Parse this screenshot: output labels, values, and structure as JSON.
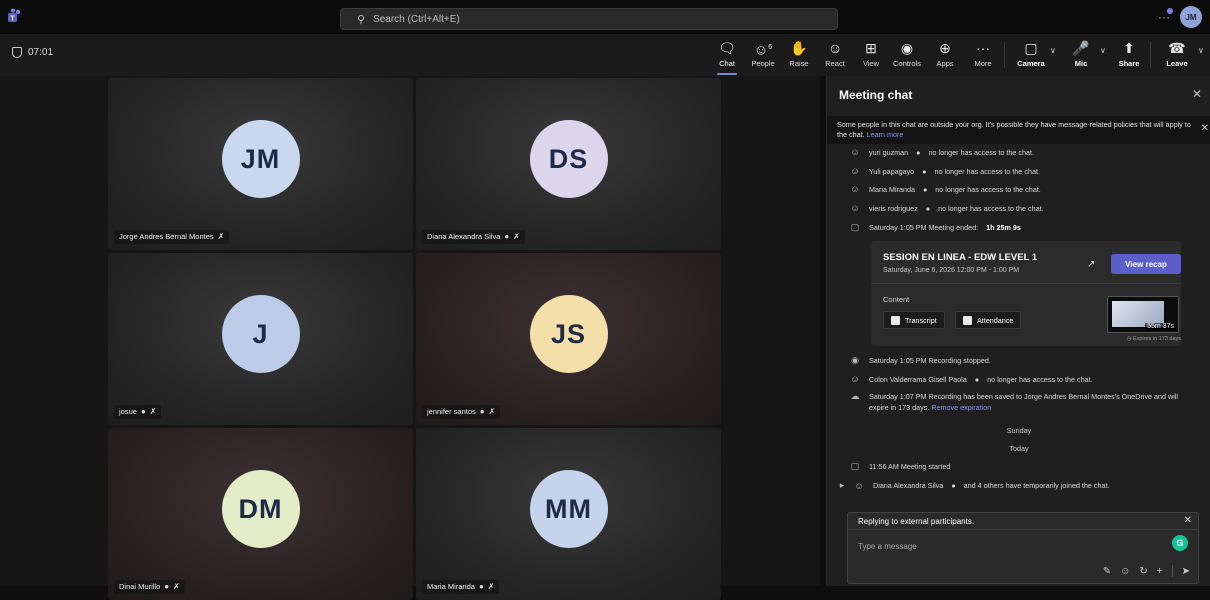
{
  "topbar": {
    "search_placeholder": "Search (Ctrl+Alt+E)",
    "user_initials": "JM"
  },
  "controlbar": {
    "timer": "07:01",
    "people_count": "6",
    "buttons": {
      "chat": "Chat",
      "people": "People",
      "raise": "Raise",
      "react": "React",
      "view": "View",
      "controls": "Controls",
      "apps": "Apps",
      "more": "More",
      "camera": "Camera",
      "mic": "Mic",
      "share": "Share",
      "leave": "Leave"
    }
  },
  "participants": [
    {
      "initials": "JM",
      "name": "Jorge Andres Bernal Montes",
      "color": "#c9d8ee"
    },
    {
      "initials": "DS",
      "name": "Diana Alexandra Silva",
      "color": "#dcd6ec"
    },
    {
      "initials": "J",
      "name": "josue",
      "color": "#bccbe8"
    },
    {
      "initials": "JS",
      "name": "jennifer santos",
      "color": "#f4dfaa"
    },
    {
      "initials": "DM",
      "name": "Dinai Murillo",
      "color": "#e2ecc7"
    },
    {
      "initials": "MM",
      "name": "Maria Miranda",
      "color": "#c6d3ed"
    }
  ],
  "chat": {
    "title": "Meeting chat",
    "banner_text": "Some people in this chat are outside your org. It's possible they have message-related policies that will apply to the chat.",
    "banner_link": "Learn more",
    "events": [
      {
        "who": "yuri guzman",
        "text": "no longer has access to the chat."
      },
      {
        "who": "Yuli papagayo",
        "text": "no longer has access to the chat."
      },
      {
        "who": "Maria Miranda",
        "text": "no longer has access to the chat."
      },
      {
        "who": "vieris rodriguez",
        "text": "no longer has access to the chat."
      }
    ],
    "meeting_ended_prefix": "Saturday 1:05 PM   Meeting ended:",
    "meeting_ended_duration": "1h 25m 9s",
    "card": {
      "title": "SESION EN LINEA - EDW LEVEL 1",
      "date": "Saturday, June 6, 2026 12:00 PM - 1:00 PM",
      "recap_button": "View recap",
      "content_label": "Content",
      "transcript": "Transcript",
      "attendance": "Attendance",
      "duration": "55m 37s",
      "expires": "Expires in 173 days"
    },
    "recording_stopped": "Saturday 1:05 PM   Recording stopped.",
    "colon_who": "Colon Valderrama Gisell Paola",
    "colon_text": "no longer has access to the chat.",
    "recording_saved": "Saturday 1:07 PM   Recording has been saved to Jorge Andres Bernal Montes's OneDrive and will expire in 173 days.",
    "remove_expiration": "Remove expiration",
    "day_sunday": "Sunday",
    "day_today": "Today",
    "meeting_started": "11:56 AM   Meeting started",
    "joined_who": "Diana Alexandra Silva",
    "joined_text": "and 4 others have temporarily joined the chat.",
    "compose": {
      "replying": "Replying to external participants.",
      "placeholder": "Type a message"
    }
  }
}
